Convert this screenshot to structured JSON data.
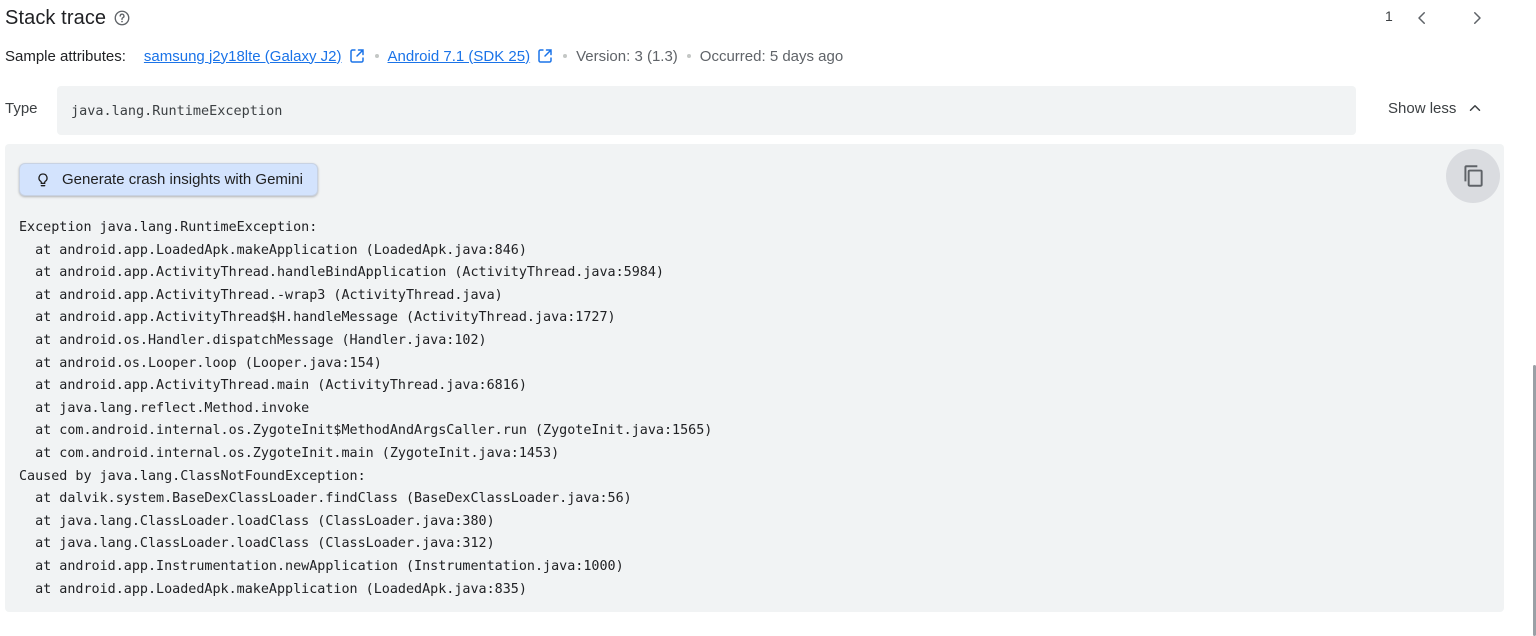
{
  "header": {
    "title": "Stack trace",
    "help_icon": "help-circle-icon",
    "pager_count": "1",
    "prev_icon": "chevron-left-icon",
    "next_icon": "chevron-right-icon"
  },
  "attributes": {
    "label": "Sample attributes:",
    "device_link": "samsung j2y18lte (Galaxy J2)",
    "os_link": "Android 7.1 (SDK 25)",
    "version": "Version: 3 (1.3)",
    "occurred": "Occurred: 5 days ago",
    "link_icon": "open-in-new-icon"
  },
  "type_row": {
    "label": "Type",
    "value": "java.lang.RuntimeException",
    "toggle_label": "Show less",
    "toggle_icon": "chevron-up-icon"
  },
  "trace": {
    "gemini_button": "Generate crash insights with Gemini",
    "gemini_icon": "lightbulb-icon",
    "copy_icon": "copy-icon",
    "lines": [
      "Exception java.lang.RuntimeException:",
      "  at android.app.LoadedApk.makeApplication (LoadedApk.java:846)",
      "  at android.app.ActivityThread.handleBindApplication (ActivityThread.java:5984)",
      "  at android.app.ActivityThread.-wrap3 (ActivityThread.java)",
      "  at android.app.ActivityThread$H.handleMessage (ActivityThread.java:1727)",
      "  at android.os.Handler.dispatchMessage (Handler.java:102)",
      "  at android.os.Looper.loop (Looper.java:154)",
      "  at android.app.ActivityThread.main (ActivityThread.java:6816)",
      "  at java.lang.reflect.Method.invoke",
      "  at com.android.internal.os.ZygoteInit$MethodAndArgsCaller.run (ZygoteInit.java:1565)",
      "  at com.android.internal.os.ZygoteInit.main (ZygoteInit.java:1453)",
      "Caused by java.lang.ClassNotFoundException:",
      "  at dalvik.system.BaseDexClassLoader.findClass (BaseDexClassLoader.java:56)",
      "  at java.lang.ClassLoader.loadClass (ClassLoader.java:380)",
      "  at java.lang.ClassLoader.loadClass (ClassLoader.java:312)",
      "  at android.app.Instrumentation.newApplication (Instrumentation.java:1000)",
      "  at android.app.LoadedApk.makeApplication (LoadedApk.java:835)"
    ]
  },
  "colors": {
    "link": "#1a73e8",
    "panel_bg": "#f1f3f4",
    "gemini_bg": "#d3e3fd",
    "text": "#202124"
  }
}
